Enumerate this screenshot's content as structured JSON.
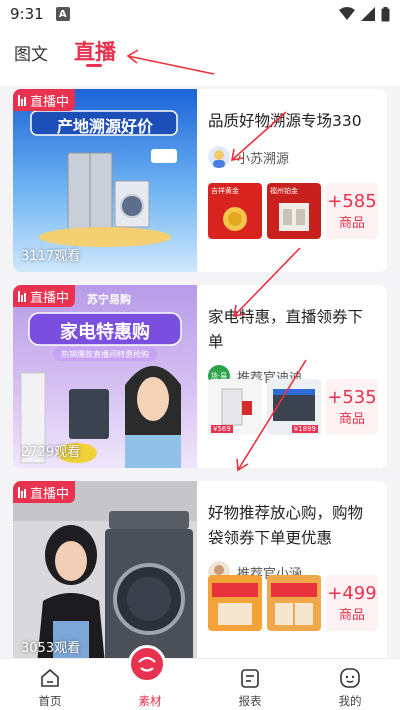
{
  "status_bar": {
    "time": "9:31",
    "a_icon": "A"
  },
  "tabs": [
    {
      "label": "图文",
      "active": false
    },
    {
      "label": "直播",
      "active": true
    }
  ],
  "accent_color": "#e8324f",
  "cards": [
    {
      "badge": "直播中",
      "banner_text": "产地溯源好价",
      "views": "3117观看",
      "title": "品质好物溯源专场330",
      "author": "小苏溯源",
      "product_thumbs": [
        "吉祥黄金",
        "福州铂金"
      ],
      "more_count": "+585",
      "more_unit": "商品"
    },
    {
      "badge": "直播中",
      "brand_text": "苏宁易购",
      "banner_text": "家电特惠购",
      "sub_text": "热销爆款直播间特惠抢购",
      "views": "2729观看",
      "title": "家电特惠，直播领券下单",
      "author": "推荐官迪迪",
      "author_avatar_text": "场·易",
      "product_thumbs": [
        "¥569",
        "¥1899"
      ],
      "more_count": "+535",
      "more_unit": "商品"
    },
    {
      "badge": "直播中",
      "views": "3053观看",
      "title": "好物推荐放心购，购物袋领券下单更优惠",
      "author": "推荐官小涵",
      "product_thumbs": [
        "",
        ""
      ],
      "more_count": "+499",
      "more_unit": "商品"
    }
  ],
  "bottom_nav": [
    {
      "label": "首页",
      "icon": "home-icon",
      "active": false
    },
    {
      "label": "素材",
      "icon": "material-icon",
      "active": true
    },
    {
      "label": "报表",
      "icon": "report-icon",
      "active": false
    },
    {
      "label": "我的",
      "icon": "profile-icon",
      "active": false
    }
  ]
}
